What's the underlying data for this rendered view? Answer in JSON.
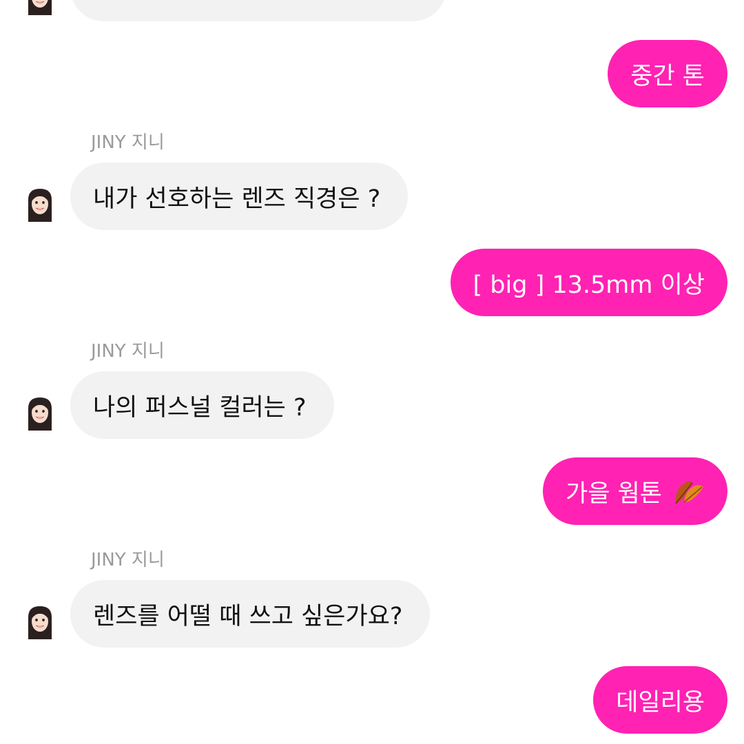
{
  "conversation": {
    "sender_name": "JINY 지니",
    "messages": [
      {
        "from": "bot",
        "text": ""
      },
      {
        "from": "user",
        "text": "중간 톤"
      },
      {
        "from": "bot",
        "text": "내가 선호하는 렌즈 직경은 ?"
      },
      {
        "from": "user",
        "text": "[ big ] 13.5mm 이상"
      },
      {
        "from": "bot",
        "text": "나의 퍼스널 컬러는 ?"
      },
      {
        "from": "user",
        "text": "가을 웜톤",
        "emoji": "fallen-leaf-icon"
      },
      {
        "from": "bot",
        "text": "렌즈를 어떨 때 쓰고 싶은가요?"
      },
      {
        "from": "user",
        "text": "데일리용"
      }
    ]
  },
  "colors": {
    "user_bubble": "#ff22b3",
    "bot_bubble": "#f2f2f2",
    "sender_name": "#9a9a9a"
  }
}
